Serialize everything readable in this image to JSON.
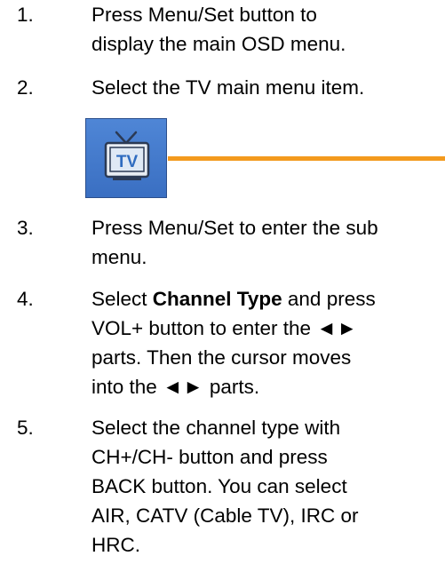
{
  "steps": [
    {
      "number": "1.",
      "lines": [
        "Press Menu/Set button to",
        "display the main OSD menu."
      ]
    },
    {
      "number": "2.",
      "lines": [
        "Select the TV main menu item."
      ]
    },
    {
      "number": "3.",
      "lines": [
        "Press Menu/Set to enter the sub",
        "menu."
      ]
    },
    {
      "number": "4.",
      "pre_bold": "Select ",
      "bold": "Channel Type",
      "post_bold": " and press",
      "line2": "VOL+ button to enter the",
      "arrows": "◄►",
      "line3": "parts. Then the cursor moves",
      "line4_pre": "into the",
      "line4_post": "parts."
    },
    {
      "number": "5.",
      "lines": [
        "Select the channel type with",
        "CH+/CH- button and press",
        "BACK button. You can select",
        "AIR, CATV (Cable TV), IRC or",
        "HRC."
      ]
    }
  ],
  "tv_icon": {
    "label": "TV",
    "icon": "tv-icon",
    "box_color": "#4a80d0",
    "line_color": "#f39a1e"
  }
}
